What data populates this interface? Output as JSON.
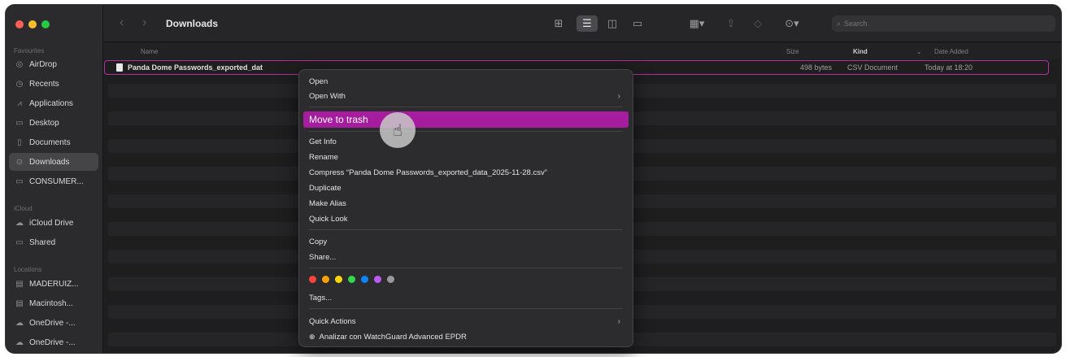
{
  "window": {
    "title": "Downloads"
  },
  "traffic_lights": [
    "#ff5f57",
    "#febc2e",
    "#28c840"
  ],
  "sidebar": {
    "favourites_label": "Favourites",
    "icloud_label": "iCloud",
    "locations_label": "Locations",
    "favourites": [
      {
        "label": "AirDrop",
        "icon": "airdrop-icon",
        "glyph": "◎"
      },
      {
        "label": "Recents",
        "icon": "clock-icon",
        "glyph": "◷"
      },
      {
        "label": "Applications",
        "icon": "applications-icon",
        "glyph": "⩘"
      },
      {
        "label": "Desktop",
        "icon": "desktop-icon",
        "glyph": "▭"
      },
      {
        "label": "Documents",
        "icon": "document-icon",
        "glyph": "▯"
      },
      {
        "label": "Downloads",
        "icon": "downloads-icon",
        "glyph": "⊙"
      },
      {
        "label": "CONSUMER...",
        "icon": "folder-icon",
        "glyph": "▭"
      }
    ],
    "icloud": [
      {
        "label": "iCloud Drive",
        "icon": "cloud-icon",
        "glyph": "☁"
      },
      {
        "label": "Shared",
        "icon": "shared-folder-icon",
        "glyph": "▭"
      }
    ],
    "locations": [
      {
        "label": "MADERUIZ...",
        "icon": "drive-icon",
        "glyph": "▤"
      },
      {
        "label": "Macintosh...",
        "icon": "disk-icon",
        "glyph": "▤"
      },
      {
        "label": "OneDrive -...",
        "icon": "cloud-icon",
        "glyph": "☁"
      },
      {
        "label": "OneDrive -...",
        "icon": "cloud-icon",
        "glyph": "☁"
      }
    ]
  },
  "toolbar": {
    "search_placeholder": "Search"
  },
  "columns": {
    "name": "Name",
    "size": "Size",
    "kind": "Kind",
    "date_added": "Date Added"
  },
  "file": {
    "name": "Panda Dome Passwords_exported_dat",
    "size": "498 bytes",
    "kind": "CSV Document",
    "date_added": "Today at 18:20"
  },
  "context_menu": {
    "open": "Open",
    "open_with": "Open With",
    "move_to_trash": "Move to trash",
    "get_info": "Get Info",
    "rename": "Rename",
    "compress": "Compress “Panda Dome Passwords_exported_data_2025-11-28.csv”",
    "duplicate": "Duplicate",
    "make_alias": "Make Alias",
    "quick_look": "Quick Look",
    "copy": "Copy",
    "share": "Share...",
    "tags": "Tags...",
    "quick_actions": "Quick Actions",
    "analyze": "Analizar con WatchGuard Advanced EPDR",
    "tag_colors": [
      "#ff453a",
      "#ff9f0a",
      "#ffd60a",
      "#32d74b",
      "#0a84ff",
      "#bf5af2",
      "#98989d"
    ],
    "highlight_color": "#a51c9e"
  }
}
